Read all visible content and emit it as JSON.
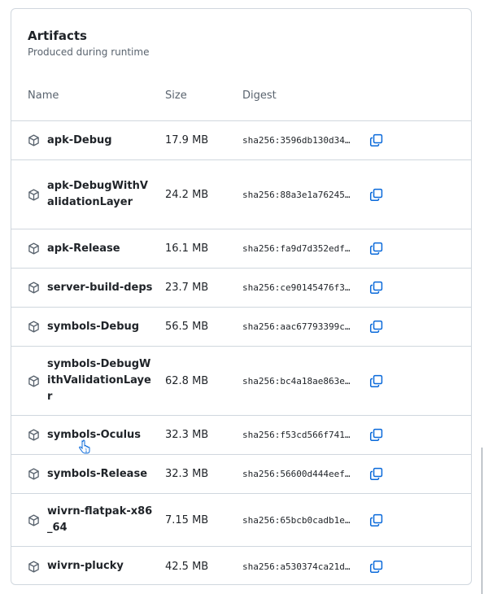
{
  "panel": {
    "title": "Artifacts",
    "subtitle": "Produced during runtime"
  },
  "table": {
    "headers": {
      "name": "Name",
      "size": "Size",
      "digest": "Digest"
    },
    "rows": [
      {
        "name": "apk-Debug",
        "size": "17.9 MB",
        "digest": "sha256:3596db130d34…"
      },
      {
        "name": "apk-DebugWithValidationLayer",
        "size": "24.2 MB",
        "digest": "sha256:88a3e1a76245…"
      },
      {
        "name": "apk-Release",
        "size": "16.1 MB",
        "digest": "sha256:fa9d7d352edf…"
      },
      {
        "name": "server-build-deps",
        "size": "23.7 MB",
        "digest": "sha256:ce90145476f3…"
      },
      {
        "name": "symbols-Debug",
        "size": "56.5 MB",
        "digest": "sha256:aac67793399c…"
      },
      {
        "name": "symbols-DebugWithValidationLayer",
        "size": "62.8 MB",
        "digest": "sha256:bc4a18ae863e…"
      },
      {
        "name": "symbols-Oculus",
        "size": "32.3 MB",
        "digest": "sha256:f53cd566f741…"
      },
      {
        "name": "symbols-Release",
        "size": "32.3 MB",
        "digest": "sha256:56600d444eef…"
      },
      {
        "name": "wivrn-flatpak-x86_64",
        "size": "7.15 MB",
        "digest": "sha256:65bcb0cadb1e…"
      },
      {
        "name": "wivrn-plucky",
        "size": "42.5 MB",
        "digest": "sha256:a530374ca21d…"
      }
    ]
  },
  "icons": {
    "artifact": "package-icon",
    "copy": "copy-icon"
  },
  "colors": {
    "accent": "#0969da",
    "border": "#d0d7de",
    "muted": "#59636e"
  }
}
